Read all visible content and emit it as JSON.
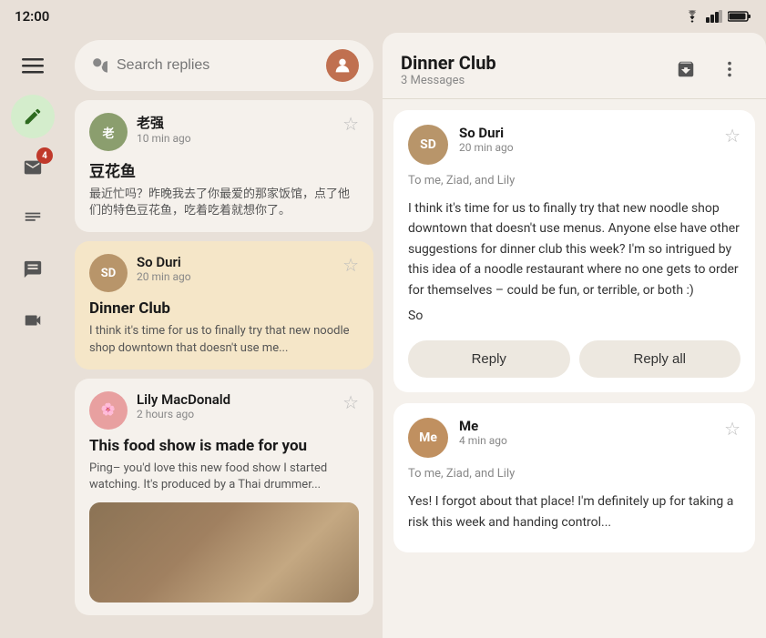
{
  "status_bar": {
    "time": "12:00",
    "wifi_icon": "▲",
    "signal_icon": "▲",
    "battery_icon": "▮"
  },
  "sidebar": {
    "menu_icon": "☰",
    "compose_icon": "✏",
    "mail_icon": "✉",
    "mail_badge": "4",
    "notes_icon": "☰",
    "chat_icon": "💬",
    "meet_icon": "🎥"
  },
  "search": {
    "placeholder": "Search replies",
    "user_avatar_initials": "U"
  },
  "messages": [
    {
      "id": "msg-1",
      "sender": "老强",
      "sender_initials": "老",
      "sender_color": "#8b9e6e",
      "time": "10 min ago",
      "subject": "豆花鱼",
      "preview": "最近忙吗？昨晚我去了你最爱的那家饭馆，点了他们的特色豆花鱼，吃着吃着就想你了。",
      "active": false,
      "starred": false,
      "has_image": false
    },
    {
      "id": "msg-2",
      "sender": "So Duri",
      "sender_initials": "SD",
      "sender_color": "#b8956a",
      "time": "20 min ago",
      "subject": "Dinner Club",
      "preview": "I think it's time for us to finally try that new noodle shop downtown that doesn't use me...",
      "active": true,
      "starred": false,
      "has_image": false
    },
    {
      "id": "msg-3",
      "sender": "Lily MacDonald",
      "sender_initials": "🌸",
      "sender_color": "#e8a0a0",
      "time": "2 hours ago",
      "subject": "This food show is made for you",
      "preview": "Ping– you'd love this new food show I started watching. It's produced by a Thai drummer...",
      "active": false,
      "starred": false,
      "has_image": true
    }
  ],
  "detail": {
    "title": "Dinner Club",
    "subtitle": "3 Messages",
    "archive_icon": "⊡",
    "more_icon": "⋮"
  },
  "thread": [
    {
      "id": "thread-1",
      "sender": "So Duri",
      "sender_initials": "SD",
      "sender_color": "#b8956a",
      "time": "20 min ago",
      "recipients": "To me, Ziad, and Lily",
      "body": "I think it's time for us to finally try that new noodle shop downtown that doesn't use menus. Anyone else have other suggestions for dinner club this week? I'm so intrigued by this idea of a noodle restaurant where no one gets to order for themselves – could be fun, or terrible, or both :)\n\nSo",
      "starred": false,
      "show_reply_buttons": true,
      "reply_label": "Reply",
      "reply_all_label": "Reply all"
    },
    {
      "id": "thread-2",
      "sender": "Me",
      "sender_initials": "Me",
      "sender_color": "#c09060",
      "time": "4 min ago",
      "recipients": "To me, Ziad, and Lily",
      "body": "Yes! I forgot about that place! I'm definitely up for taking a risk this week and handing control...",
      "starred": false,
      "show_reply_buttons": false
    }
  ]
}
